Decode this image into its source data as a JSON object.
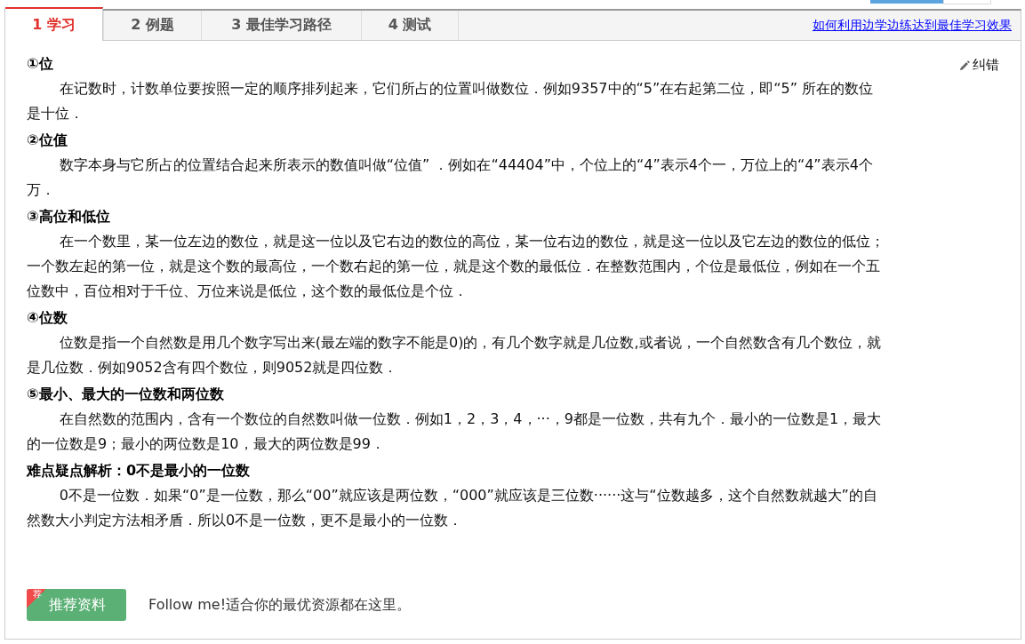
{
  "tabs": [
    {
      "label": "1 学习",
      "selected": true
    },
    {
      "label": "2 例题",
      "selected": false
    },
    {
      "label": "3 最佳学习路径",
      "selected": false
    },
    {
      "label": "4 测试",
      "selected": false
    }
  ],
  "help_link": "如何利用边学边练达到最佳学习效果",
  "report_error": "纠错",
  "sections": [
    {
      "heading": "①位",
      "body": "在记数时，计数单位要按照一定的顺序排列起来，它们所占的位置叫做数位．例如9357中的“5”在右起第二位，即“5” 所在的数位是十位．"
    },
    {
      "heading": "②位值",
      "body": "数字本身与它所占的位置结合起来所表示的数值叫做“位值” ．例如在“44404”中，个位上的“4”表示4个一，万位上的“4”表示4个万．"
    },
    {
      "heading": "③高位和低位",
      "body": "在一个数里，某一位左边的数位，就是这一位以及它右边的数位的高位，某一位右边的数位，就是这一位以及它左边的数位的低位；一个数左起的第一位，就是这个数的最高位，一个数右起的第一位，就是这个数的最低位．在整数范围内，个位是最低位，例如在一个五位数中，百位相对于千位、万位来说是低位，这个数的最低位是个位．"
    },
    {
      "heading": "④位数",
      "body": "位数是指一个自然数是用几个数字写出来(最左端的数字不能是0)的，有几个数字就是几位数,或者说，一个自然数含有几个数位，就是几位数．例如9052含有四个数位，则9052就是四位数．"
    },
    {
      "heading": "⑤最小、最大的一位数和两位数",
      "body": "在自然数的范围内，含有一个数位的自然数叫做一位数．例如1，2，3，4，···，9都是一位数，共有九个．最小的一位数是1，最大的一位数是9；最小的两位数是10，最大的两位数是99．"
    },
    {
      "heading": "难点疑点解析：0不是最小的一位数",
      "body": "0不是一位数．如果“0”是一位数，那么“00”就应该是两位数，“000”就应该是三位数······这与“位数越多，这个自然数就越大”的自然数大小判定方法相矛盾．所以0不是一位数，更不是最小的一位数．"
    }
  ],
  "recommend": {
    "badge": "荐",
    "button": "推荐资料",
    "text": "Follow me!适合你的最优资源都在这里。"
  }
}
